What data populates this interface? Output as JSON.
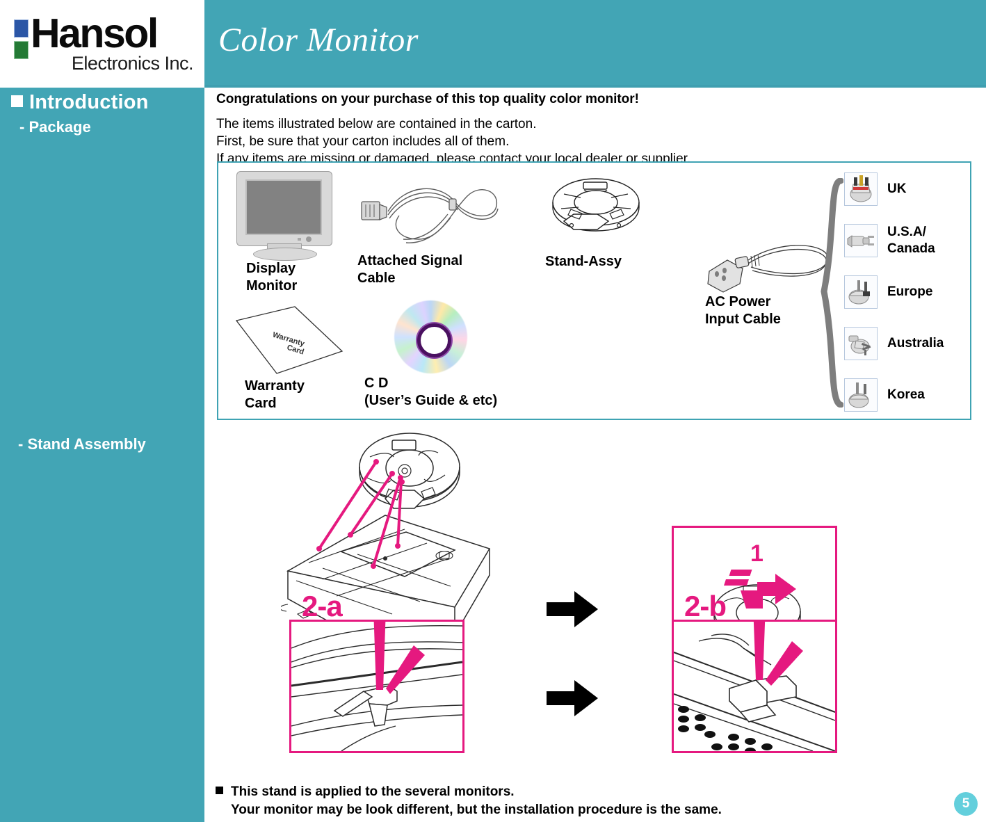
{
  "brand": {
    "logo_word": "Hansol",
    "logo_sub": "Electronics Inc.",
    "square_blue": "#2b56a6",
    "square_green": "#247a35"
  },
  "header": {
    "title": "Color Monitor",
    "band_color": "#42a5b5"
  },
  "sidebar": {
    "heading": "Introduction",
    "items": [
      {
        "label": "- Package"
      },
      {
        "label": "- Stand Assembly"
      }
    ]
  },
  "main": {
    "lead": "Congratulations on your purchase of this top quality color monitor!",
    "body": "The items illustrated below are contained in the carton.\nFirst, be sure that your carton includes all of them.\nIf any items are missing or damaged, please contact your local dealer or supplier."
  },
  "package": {
    "border_color": "#3fa3b3",
    "items": [
      {
        "id": "display-monitor",
        "caption": "Display\nMonitor"
      },
      {
        "id": "attached-signal-cable",
        "caption": "Attached Signal\nCable"
      },
      {
        "id": "stand-assy",
        "caption": "Stand-Assy"
      },
      {
        "id": "warranty-card",
        "caption": "Warranty\n Card"
      },
      {
        "id": "cd",
        "caption": "C D\n(User’s Guide & etc)"
      },
      {
        "id": "ac-power-input-cable",
        "caption": "AC Power\nInput  Cable"
      }
    ],
    "warranty_card_text": "Warranty\nCard",
    "plugs": [
      {
        "region": "UK"
      },
      {
        "region": "U.S.A/\nCanada"
      },
      {
        "region": "Europe"
      },
      {
        "region": "Australia"
      },
      {
        "region": "Korea"
      }
    ]
  },
  "assembly": {
    "step_labels": {
      "step1": "1",
      "step2a": "2-a",
      "step2b": "2-b"
    },
    "accent_color": "#e5197f"
  },
  "note": {
    "line1": "This stand is applied to the several monitors.",
    "line2": "Your monitor may be look different, but the installation procedure is the same."
  },
  "footer": {
    "page_number": "5",
    "badge_color": "#63cfdc"
  }
}
